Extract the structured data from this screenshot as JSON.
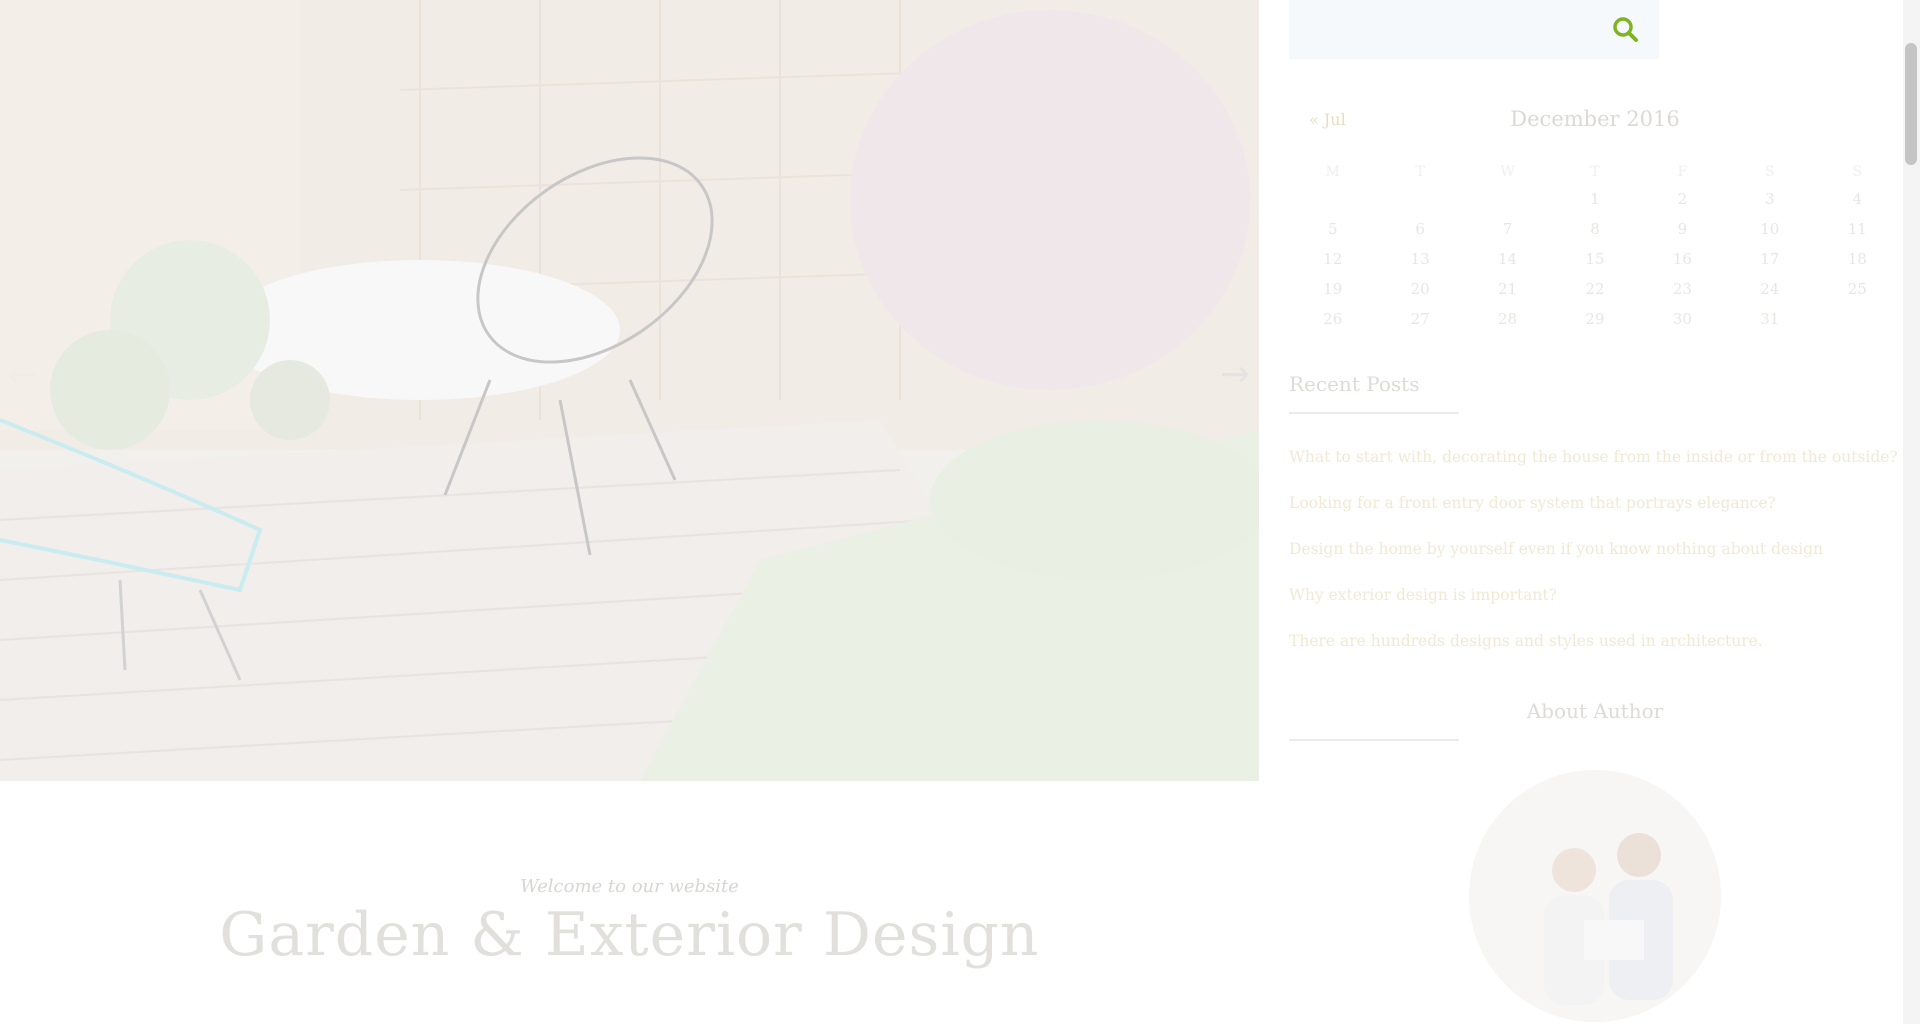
{
  "slider": {
    "prev_arrow": "←",
    "next_arrow": "→",
    "image_description_icon": "garden-photo"
  },
  "welcome": {
    "subtitle": "Welcome to our website",
    "title": "Garden & Exterior Design"
  },
  "search": {
    "placeholder": "",
    "icon": "search-icon",
    "accent_color": "#7fb421"
  },
  "calendar": {
    "prev_link": "« Jul",
    "caption": "December 2016",
    "weekdays": [
      "M",
      "T",
      "W",
      "T",
      "F",
      "S",
      "S"
    ],
    "weeks": [
      [
        "",
        "",
        "",
        "1",
        "2",
        "3",
        "4"
      ],
      [
        "5",
        "6",
        "7",
        "8",
        "9",
        "10",
        "11"
      ],
      [
        "12",
        "13",
        "14",
        "15",
        "16",
        "17",
        "18"
      ],
      [
        "19",
        "20",
        "21",
        "22",
        "23",
        "24",
        "25"
      ],
      [
        "26",
        "27",
        "28",
        "29",
        "30",
        "31",
        ""
      ]
    ]
  },
  "recent_posts": {
    "title": "Recent Posts",
    "items": [
      "What to start with, decorating the house from the inside or from the outside?",
      "Looking for a front entry door system that portrays elegance?",
      "Design the home by yourself even if you know nothing about design",
      "Why exterior design is important?",
      "There are hundreds designs and styles used in architecture."
    ]
  },
  "about_author": {
    "title": "About Author"
  }
}
